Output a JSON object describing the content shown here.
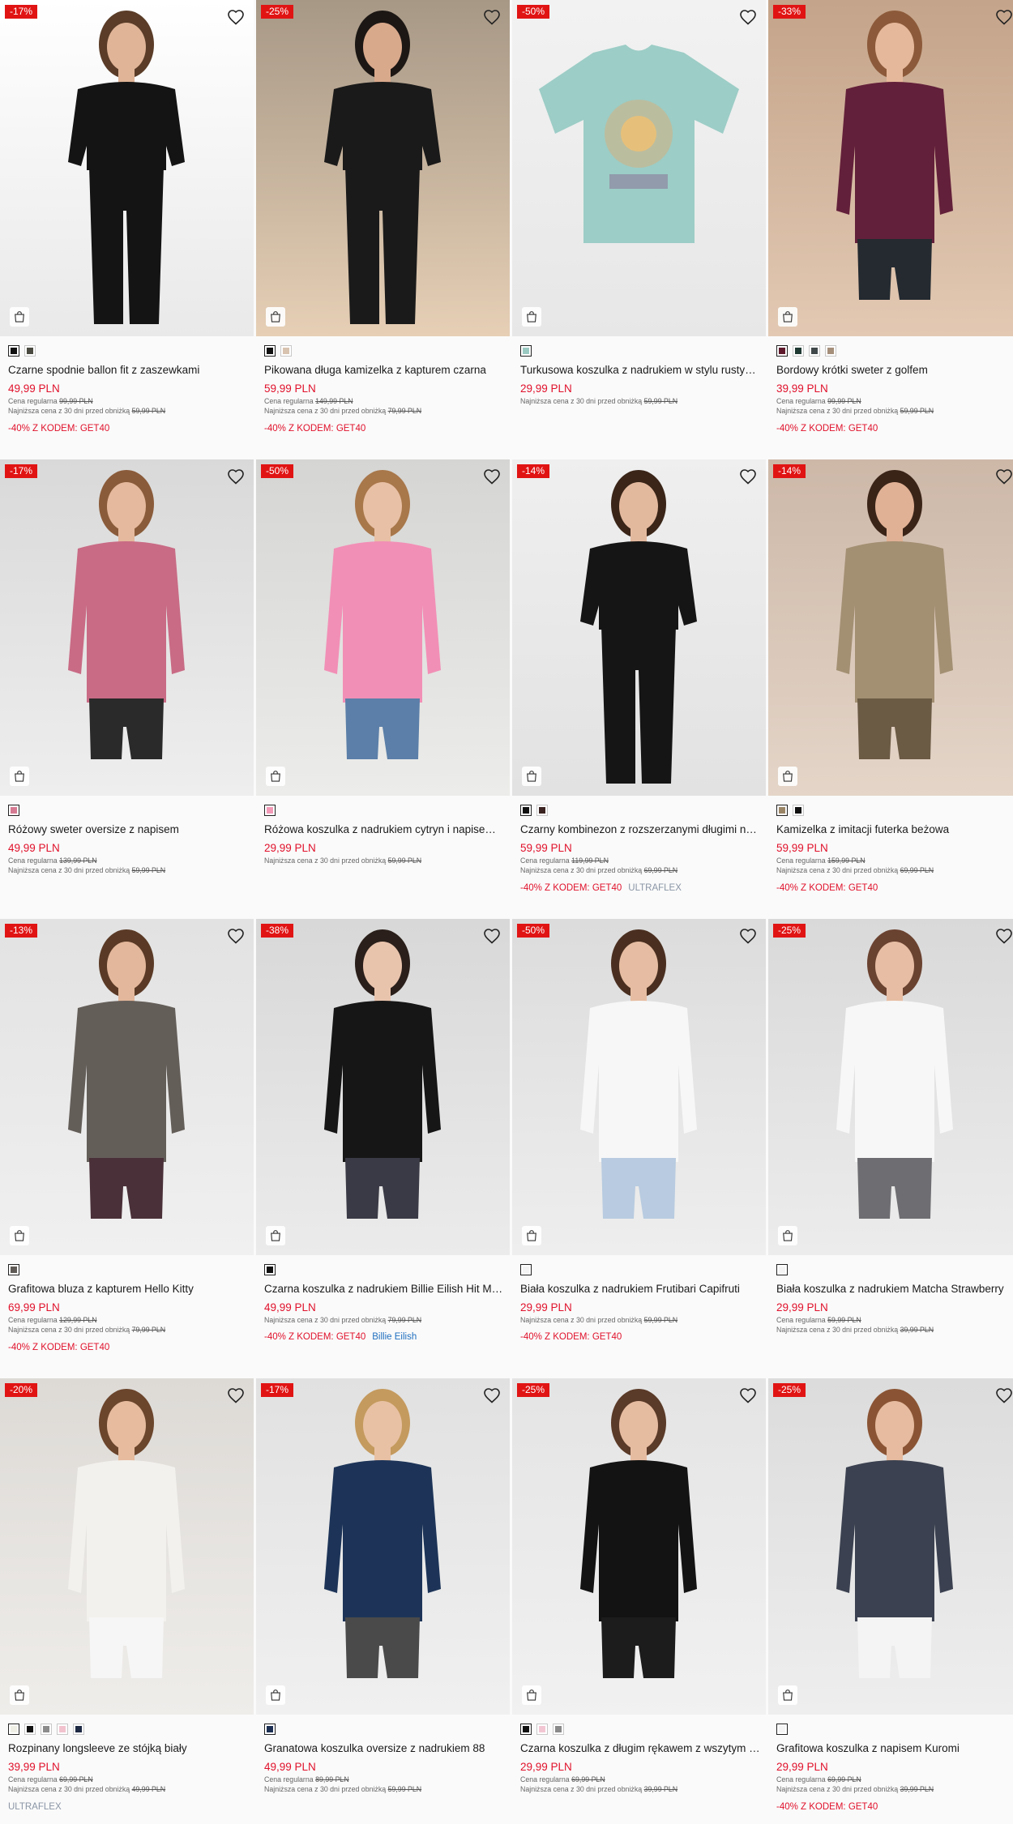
{
  "labels": {
    "regular_prefix": "Cena regularna",
    "lowest_prefix": "Najniższa cena z 30 dni przed obniżką"
  },
  "products": [
    {
      "discount": "-17%",
      "name": "Czarne spodnie ballon fit z zaszewkami",
      "price": "49,99 PLN",
      "regular": "99,99 PLN",
      "lowest": "59,99 PLN",
      "promo": "-40% Z KODEM: GET40",
      "tag": "",
      "swatches": [
        "#111111",
        "#4a4a40"
      ],
      "bg": [
        "#ffffff",
        "#e9e9e9"
      ],
      "garment": "#141414",
      "hair": "#5a3c28",
      "skin": "#e0b497"
    },
    {
      "discount": "-25%",
      "name": "Pikowana długa kamizelka z kapturem czarna",
      "price": "59,99 PLN",
      "regular": "149,99 PLN",
      "lowest": "79,99 PLN",
      "promo": "-40% Z KODEM: GET40",
      "tag": "",
      "swatches": [
        "#111111",
        "#d8c3b0"
      ],
      "bg": [
        "#a79886",
        "#e6cfb5"
      ],
      "garment": "#1a1a1a",
      "hair": "#1c1714",
      "skin": "#d9a98c"
    },
    {
      "discount": "-50%",
      "name": "Turkusowa koszulka z nadrukiem w stylu rustykalnym",
      "price": "29,99 PLN",
      "regular": "",
      "lowest": "59,99 PLN",
      "promo": "",
      "tag": "",
      "swatches": [
        "#9ac9c2"
      ],
      "bg": [
        "#f2f2f2",
        "#e7e7e7"
      ],
      "garment": "#9ccdc6",
      "hair": "",
      "skin": ""
    },
    {
      "discount": "-33%",
      "name": "Bordowy krótki sweter z golfem",
      "price": "39,99 PLN",
      "regular": "99,99 PLN",
      "lowest": "59,99 PLN",
      "promo": "-40% Z KODEM: GET40",
      "tag": "",
      "swatches": [
        "#5e1a2c",
        "#1f3a33",
        "#40484a",
        "#a58f7b"
      ],
      "bg": [
        "#c4a48a",
        "#e3c9b3"
      ],
      "garment": "#63203a",
      "hair": "#8c5a3a",
      "skin": "#e6b89b"
    },
    {
      "discount": "-17%",
      "name": "Różowy sweter oversize z napisem",
      "price": "49,99 PLN",
      "regular": "139,99 PLN",
      "lowest": "59,99 PLN",
      "promo": "",
      "tag": "",
      "swatches": [
        "#d57a92"
      ],
      "bg": [
        "#d9d9d9",
        "#eeeeee"
      ],
      "garment": "#c96b85",
      "hair": "#8a5b3a",
      "skin": "#e5b99d"
    },
    {
      "discount": "-50%",
      "name": "Różowa koszulka z nadrukiem cytryn i napisem La Dolce Vita",
      "price": "29,99 PLN",
      "regular": "",
      "lowest": "59,99 PLN",
      "promo": "",
      "tag": "",
      "swatches": [
        "#f29ab7"
      ],
      "bg": [
        "#d5d5d3",
        "#ececea"
      ],
      "garment": "#f28fb6",
      "hair": "#a8774a",
      "skin": "#e8c0a5"
    },
    {
      "discount": "-14%",
      "name": "Czarny kombinezon z rozszerzanymi długimi nogawkami",
      "price": "59,99 PLN",
      "regular": "119,99 PLN",
      "lowest": "69,99 PLN",
      "promo": "-40% Z KODEM: GET40",
      "tag": "ULTRAFLEX",
      "swatches": [
        "#111111",
        "#3a2320"
      ],
      "bg": [
        "#efefef",
        "#e2e2e2"
      ],
      "garment": "#151515",
      "hair": "#3a2518",
      "skin": "#e3b99e"
    },
    {
      "discount": "-14%",
      "name": "Kamizelka z imitacji futerka beżowa",
      "price": "59,99 PLN",
      "regular": "159,99 PLN",
      "lowest": "69,99 PLN",
      "promo": "-40% Z KODEM: GET40",
      "tag": "",
      "swatches": [
        "#9a8566",
        "#111111"
      ],
      "bg": [
        "#cdb8a8",
        "#e4d5c8"
      ],
      "garment": "#a38f72",
      "hair": "#3a2418",
      "skin": "#e1b195"
    },
    {
      "discount": "-13%",
      "name": "Grafitowa bluza z kapturem Hello Kitty",
      "price": "69,99 PLN",
      "regular": "129,99 PLN",
      "lowest": "79,99 PLN",
      "promo": "-40% Z KODEM: GET40",
      "tag": "",
      "swatches": [
        "#5f5a55"
      ],
      "bg": [
        "#e2e2e2",
        "#f0f0f0"
      ],
      "garment": "#645e59",
      "hair": "#5a3a26",
      "skin": "#e3b79b"
    },
    {
      "discount": "-38%",
      "name": "Czarna koszulka z nadrukiem Billie Eilish Hit Me Hard and Soft",
      "price": "49,99 PLN",
      "regular": "",
      "lowest": "79,99 PLN",
      "promo": "-40% Z KODEM: GET40",
      "tag": "Billie Eilish",
      "swatches": [
        "#111111"
      ],
      "bg": [
        "#d8d8d8",
        "#ebebeb"
      ],
      "garment": "#161616",
      "hair": "#2a1f1a",
      "skin": "#e9c4ad"
    },
    {
      "discount": "-50%",
      "name": "Biała koszulka z nadrukiem Frutibari Capifruti",
      "price": "29,99 PLN",
      "regular": "",
      "lowest": "59,99 PLN",
      "promo": "-40% Z KODEM: GET40",
      "tag": "",
      "swatches": [
        "#f4f4f4"
      ],
      "bg": [
        "#dcdcdc",
        "#eeeeee"
      ],
      "garment": "#f7f7f7",
      "hair": "#4a2f20",
      "skin": "#e6bda2"
    },
    {
      "discount": "-25%",
      "name": "Biała koszulka z nadrukiem Matcha Strawberry",
      "price": "29,99 PLN",
      "regular": "59,99 PLN",
      "lowest": "39,99 PLN",
      "promo": "",
      "tag": "",
      "swatches": [
        "#f4f4f4"
      ],
      "bg": [
        "#d9d9d9",
        "#ececec"
      ],
      "garment": "#f7f7f7",
      "hair": "#6a4230",
      "skin": "#e7bea4"
    },
    {
      "discount": "-20%",
      "name": "Rozpinany longsleeve ze stójką biały",
      "price": "39,99 PLN",
      "regular": "69,99 PLN",
      "lowest": "49,99 PLN",
      "promo": "",
      "tag": "ULTRAFLEX",
      "swatches": [
        "#efefe6",
        "#111111",
        "#8c8c8c",
        "#f2c3cf",
        "#1e2a44"
      ],
      "bg": [
        "#dddad6",
        "#efedea"
      ],
      "garment": "#f3f1ed",
      "hair": "#6b452c",
      "skin": "#e6bb9e"
    },
    {
      "discount": "-17%",
      "name": "Granatowa koszulka oversize z nadrukiem 88",
      "price": "49,99 PLN",
      "regular": "89,99 PLN",
      "lowest": "59,99 PLN",
      "promo": "",
      "tag": "",
      "swatches": [
        "#1c2f52"
      ],
      "bg": [
        "#e1e1e1",
        "#f0f0f0"
      ],
      "garment": "#1d3458",
      "hair": "#c49a5e",
      "skin": "#e8c1a4"
    },
    {
      "discount": "-25%",
      "name": "Czarna koszulka z długim rękawem z wszytym topem",
      "price": "29,99 PLN",
      "regular": "69,99 PLN",
      "lowest": "39,99 PLN",
      "promo": "",
      "tag": "",
      "swatches": [
        "#111111",
        "#f3c6d3",
        "#8a8a8a"
      ],
      "bg": [
        "#e4e4e4",
        "#f1f1f1"
      ],
      "garment": "#131313",
      "hair": "#5a3a28",
      "skin": "#e6bca1"
    },
    {
      "discount": "-25%",
      "name": "Grafitowa koszulka z napisem Kuromi",
      "price": "29,99 PLN",
      "regular": "69,99 PLN",
      "lowest": "39,99 PLN",
      "promo": "-40% Z KODEM: GET40",
      "tag": "",
      "swatches": [
        "#f4f4f4"
      ],
      "bg": [
        "#dcdcdc",
        "#eeeeee"
      ],
      "garment": "#3b4150",
      "hair": "#8a5434",
      "skin": "#e6bb9f"
    }
  ]
}
